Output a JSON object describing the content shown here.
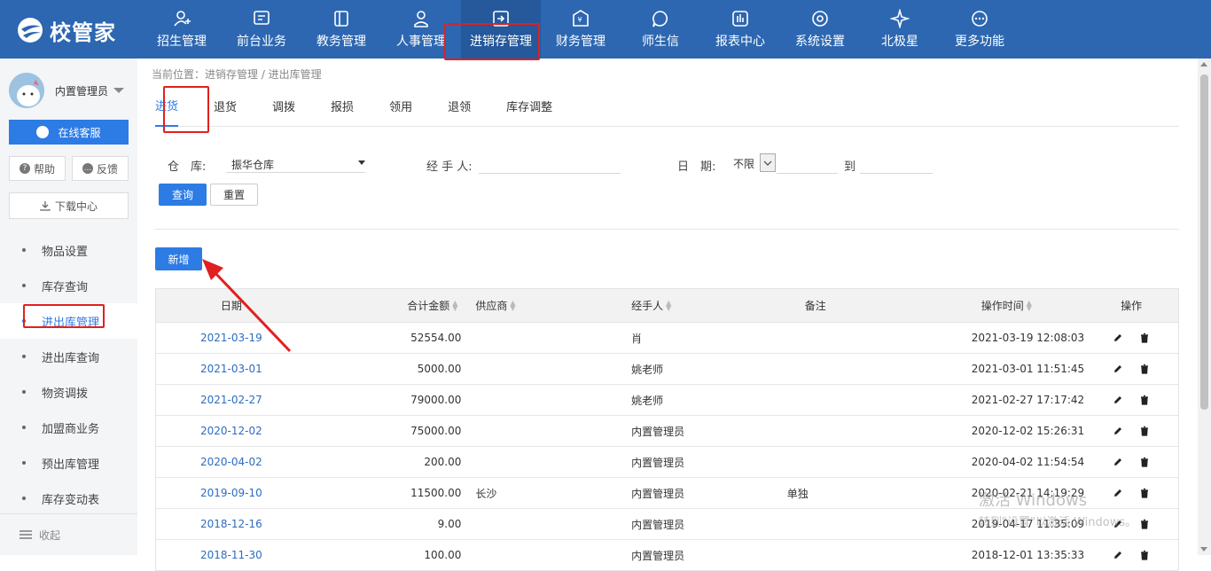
{
  "app": {
    "logo_text": "校管家"
  },
  "nav": [
    {
      "label": "招生管理",
      "icon": "person-add-icon"
    },
    {
      "label": "前台业务",
      "icon": "screen-icon"
    },
    {
      "label": "教务管理",
      "icon": "book-icon"
    },
    {
      "label": "人事管理",
      "icon": "person-icon"
    },
    {
      "label": "进销存管理",
      "icon": "inout-icon"
    },
    {
      "label": "财务管理",
      "icon": "yen-icon"
    },
    {
      "label": "师生信",
      "icon": "chat-bubble-icon"
    },
    {
      "label": "报表中心",
      "icon": "bar-chart-icon"
    },
    {
      "label": "系统设置",
      "icon": "gear-icon"
    },
    {
      "label": "北极星",
      "icon": "star-icon"
    },
    {
      "label": "更多功能",
      "icon": "more-icon"
    }
  ],
  "sidebar": {
    "user_name": "内置管理员",
    "online_service": "在线客服",
    "help": "帮助",
    "feedback": "反馈",
    "download": "下载中心",
    "items": [
      "物品设置",
      "库存查询",
      "进出库管理",
      "进出库查询",
      "物资调拨",
      "加盟商业务",
      "预出库管理",
      "库存变动表"
    ],
    "collapse": "收起"
  },
  "breadcrumb": "当前位置：进销存管理 / 进出库管理",
  "tabs": [
    "进货",
    "退货",
    "调拨",
    "报损",
    "领用",
    "退领",
    "库存调整"
  ],
  "filters": {
    "warehouse_label": "仓　库:",
    "warehouse_value": "振华仓库",
    "handler_label": "经 手 人:",
    "date_label": "日　期:",
    "date_select": "不限",
    "to_label": "到",
    "query": "查询",
    "reset": "重置"
  },
  "new_button": "新增",
  "table": {
    "headers": {
      "date": "日期",
      "amount": "合计金额",
      "supplier": "供应商",
      "handler": "经手人",
      "note": "备注",
      "time": "操作时间",
      "ops": "操作"
    },
    "rows": [
      {
        "date": "2021-03-19",
        "amount": "52554.00",
        "supplier": "",
        "handler": "肖",
        "note": "",
        "time": "2021-03-19 12:08:03"
      },
      {
        "date": "2021-03-01",
        "amount": "5000.00",
        "supplier": "",
        "handler": "姚老师",
        "note": "",
        "time": "2021-03-01 11:51:45"
      },
      {
        "date": "2021-02-27",
        "amount": "79000.00",
        "supplier": "",
        "handler": "姚老师",
        "note": "",
        "time": "2021-02-27 17:17:42"
      },
      {
        "date": "2020-12-02",
        "amount": "75000.00",
        "supplier": "",
        "handler": "内置管理员",
        "note": "",
        "time": "2020-12-02 15:26:31"
      },
      {
        "date": "2020-04-02",
        "amount": "200.00",
        "supplier": "",
        "handler": "内置管理员",
        "note": "",
        "time": "2020-04-02 11:54:54"
      },
      {
        "date": "2019-09-10",
        "amount": "11500.00",
        "supplier": "长沙",
        "handler": "内置管理员",
        "note": "单独",
        "time": "2020-02-21 14:19:29"
      },
      {
        "date": "2018-12-16",
        "amount": "9.00",
        "supplier": "",
        "handler": "内置管理员",
        "note": "",
        "time": "2019-04-17 11:35:09"
      },
      {
        "date": "2018-11-30",
        "amount": "100.00",
        "supplier": "",
        "handler": "内置管理员",
        "note": "",
        "time": "2018-12-01 13:35:33"
      }
    ]
  },
  "watermark": {
    "line1": "激活 Windows",
    "line2": "转到\"设置\"以激活 Windows。"
  },
  "colors": {
    "topbar": "#2d67b1",
    "accent": "#2d7be5",
    "highlight": "#e02020"
  }
}
